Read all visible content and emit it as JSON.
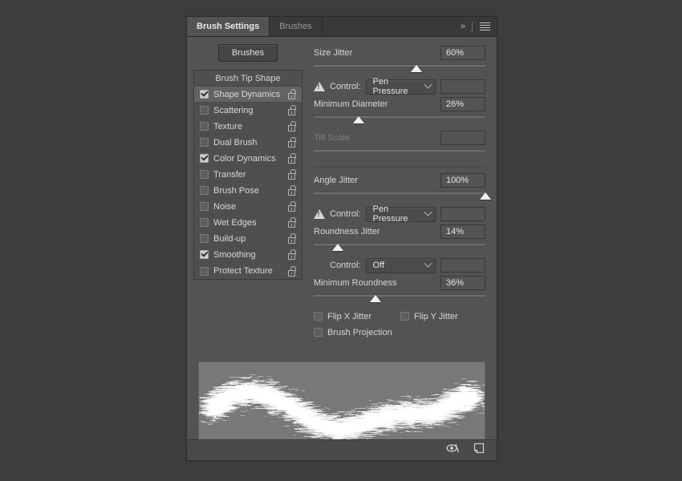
{
  "panel": {
    "tabs": [
      {
        "label": "Brush Settings",
        "active": true
      },
      {
        "label": "Brushes",
        "active": false
      }
    ],
    "expand_icon": "double-chevron-right-icon",
    "menu_icon": "panel-menu-icon"
  },
  "left": {
    "brushes_button": "Brushes",
    "list_header": "Brush Tip Shape",
    "items": [
      {
        "label": "Shape Dynamics",
        "checked": true,
        "selected": true,
        "lock": "unlocked-icon"
      },
      {
        "label": "Scattering",
        "checked": false,
        "selected": false,
        "lock": "unlocked-icon"
      },
      {
        "label": "Texture",
        "checked": false,
        "selected": false,
        "lock": "unlocked-icon"
      },
      {
        "label": "Dual Brush",
        "checked": false,
        "selected": false,
        "lock": "unlocked-icon"
      },
      {
        "label": "Color Dynamics",
        "checked": true,
        "selected": false,
        "lock": "unlocked-icon"
      },
      {
        "label": "Transfer",
        "checked": false,
        "selected": false,
        "lock": "unlocked-icon"
      },
      {
        "label": "Brush Pose",
        "checked": false,
        "selected": false,
        "lock": "unlocked-icon"
      },
      {
        "label": "Noise",
        "checked": false,
        "selected": false,
        "lock": "unlocked-icon"
      },
      {
        "label": "Wet Edges",
        "checked": false,
        "selected": false,
        "lock": "unlocked-icon"
      },
      {
        "label": "Build-up",
        "checked": false,
        "selected": false,
        "lock": "unlocked-icon"
      },
      {
        "label": "Smoothing",
        "checked": true,
        "selected": false,
        "lock": "unlocked-icon"
      },
      {
        "label": "Protect Texture",
        "checked": false,
        "selected": false,
        "lock": "unlocked-icon"
      }
    ]
  },
  "settings": {
    "size_jitter": {
      "label": "Size Jitter",
      "value": "60%",
      "slider_pct": 60
    },
    "size_control": {
      "label": "Control:",
      "value": "Pen Pressure",
      "warning": true,
      "extra_value": ""
    },
    "minimum_diameter": {
      "label": "Minimum Diameter",
      "value": "26%",
      "slider_pct": 26
    },
    "tilt_scale": {
      "label": "Tilt Scale",
      "value": "",
      "slider_pct": 0,
      "disabled": true
    },
    "angle_jitter": {
      "label": "Angle Jitter",
      "value": "100%",
      "slider_pct": 100
    },
    "angle_control": {
      "label": "Control:",
      "value": "Pen Pressure",
      "warning": true,
      "extra_value": ""
    },
    "roundness_jitter": {
      "label": "Roundness Jitter",
      "value": "14%",
      "slider_pct": 14
    },
    "roundness_control": {
      "label": "Control:",
      "value": "Off",
      "warning": false,
      "extra_value": ""
    },
    "minimum_roundness": {
      "label": "Minimum Roundness",
      "value": "36%",
      "slider_pct": 36
    },
    "flip_x_jitter": {
      "label": "Flip X Jitter",
      "checked": false
    },
    "flip_y_jitter": {
      "label": "Flip Y Jitter",
      "checked": false
    },
    "brush_projection": {
      "label": "Brush Projection",
      "checked": false
    }
  },
  "footer": {
    "toggle_preview_icon": "eye-slash-icon",
    "new_brush_icon": "new-brush-icon"
  },
  "colors": {
    "panel_bg": "#535353",
    "tabbar_bg": "#393939",
    "field_bg": "#545454",
    "text": "#d6d6d6",
    "preview_bg": "#787878",
    "stroke": "#ffffff",
    "canvas_bg": "#3d3d3d"
  }
}
